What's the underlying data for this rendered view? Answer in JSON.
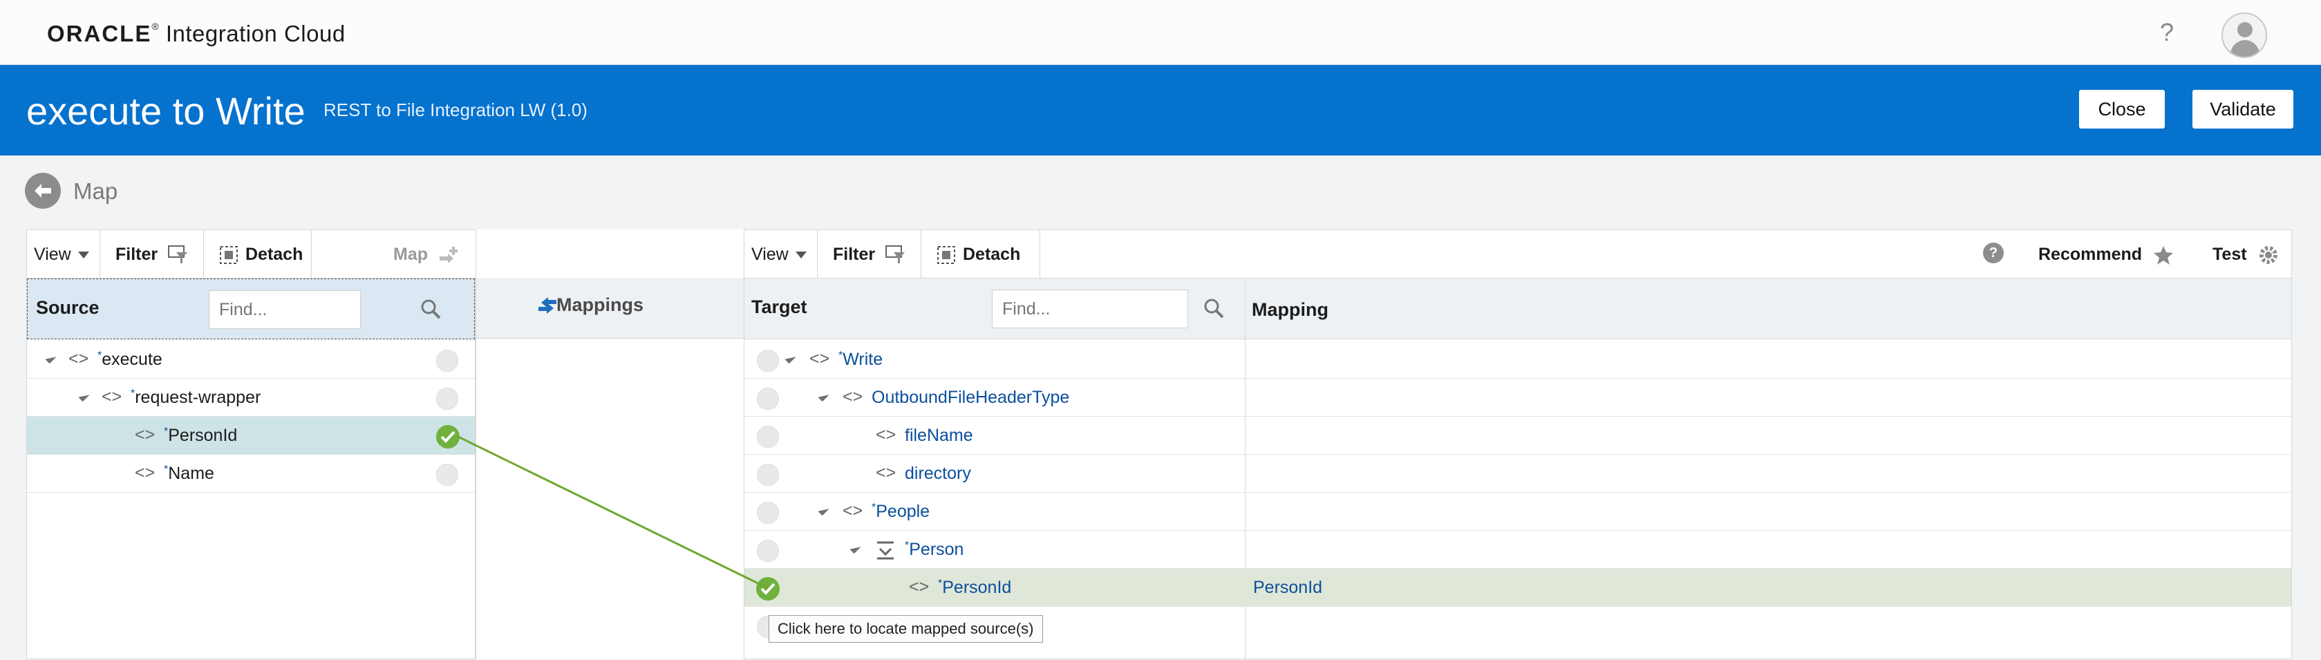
{
  "app": {
    "brand_oracle": "ORACLE",
    "brand_reg": "®",
    "brand_product": "Integration Cloud",
    "help_label": "?"
  },
  "header": {
    "title": "execute to Write",
    "subtitle": "REST to File Integration LW (1.0)",
    "close_label": "Close",
    "validate_label": "Validate"
  },
  "section": {
    "title": "Map"
  },
  "source_panel": {
    "toolbar": {
      "view": "View",
      "filter": "Filter",
      "detach": "Detach",
      "map": "Map"
    },
    "header_label": "Source",
    "find_placeholder": "Find...",
    "rows": [
      {
        "label": "execute",
        "required": "*",
        "status": "unmapped"
      },
      {
        "label": "request-wrapper",
        "required": "*",
        "status": "unmapped"
      },
      {
        "label": "PersonId",
        "required": "*",
        "status": "mapped",
        "selected": true
      },
      {
        "label": "Name",
        "required": "*",
        "status": "unmapped"
      }
    ]
  },
  "mappings_panel": {
    "label": "Mappings"
  },
  "target_panel": {
    "toolbar": {
      "view": "View",
      "filter": "Filter",
      "detach": "Detach",
      "help": "?",
      "recommend": "Recommend",
      "test": "Test"
    },
    "header_label": "Target",
    "find_placeholder": "Find...",
    "mapping_header": "Mapping",
    "rows": [
      {
        "label": "Write",
        "required": "*",
        "status": "unmapped",
        "mapping": ""
      },
      {
        "label": "OutboundFileHeaderType",
        "required": "",
        "status": "unmapped",
        "mapping": ""
      },
      {
        "label": "fileName",
        "required": "",
        "status": "unmapped",
        "mapping": ""
      },
      {
        "label": "directory",
        "required": "",
        "status": "unmapped",
        "mapping": ""
      },
      {
        "label": "People",
        "required": "*",
        "status": "unmapped",
        "mapping": ""
      },
      {
        "label": "Person",
        "required": "*",
        "status": "unmapped",
        "mapping": ""
      },
      {
        "label": "PersonId",
        "required": "*",
        "status": "mapped",
        "mapping": "PersonId",
        "selected": true
      }
    ]
  },
  "tooltip": {
    "text": "Click here to locate mapped source(s)"
  },
  "colors": {
    "brand_blue": "#0572ce",
    "mapped_green": "#6fb13c",
    "link_blue": "#0b4f9c"
  }
}
